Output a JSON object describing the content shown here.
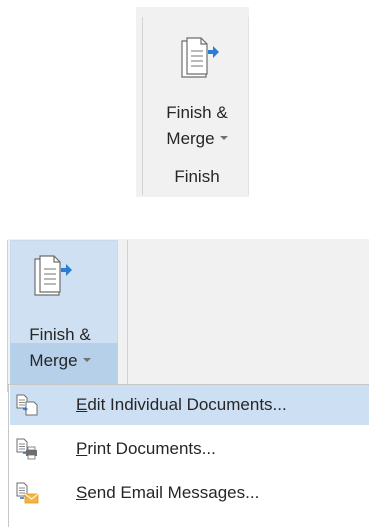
{
  "ribbon_group_closed": {
    "button": {
      "label_line1": "Finish &",
      "label_line2": "Merge",
      "icon": "finish-merge-icon"
    },
    "group_name": "Finish"
  },
  "ribbon_group_open": {
    "button": {
      "label_line1": "Finish &",
      "label_line2": "Merge",
      "icon": "finish-merge-icon"
    },
    "menu": {
      "items": [
        {
          "label": "Edit Individual Documents...",
          "accelerator": "E",
          "icon": "edit-individual-documents-icon",
          "highlighted": true
        },
        {
          "label": "Print Documents...",
          "accelerator": "P",
          "icon": "print-documents-icon",
          "highlighted": false
        },
        {
          "label": "Send Email Messages...",
          "accelerator": "S",
          "icon": "send-email-messages-icon",
          "highlighted": false
        }
      ]
    }
  },
  "colors": {
    "ribbon_bg": "#f1f1f1",
    "button_pressed": "#cfe0f2",
    "menu_hover": "#cde0f3",
    "accent_arrow": "#2b7cd3"
  }
}
